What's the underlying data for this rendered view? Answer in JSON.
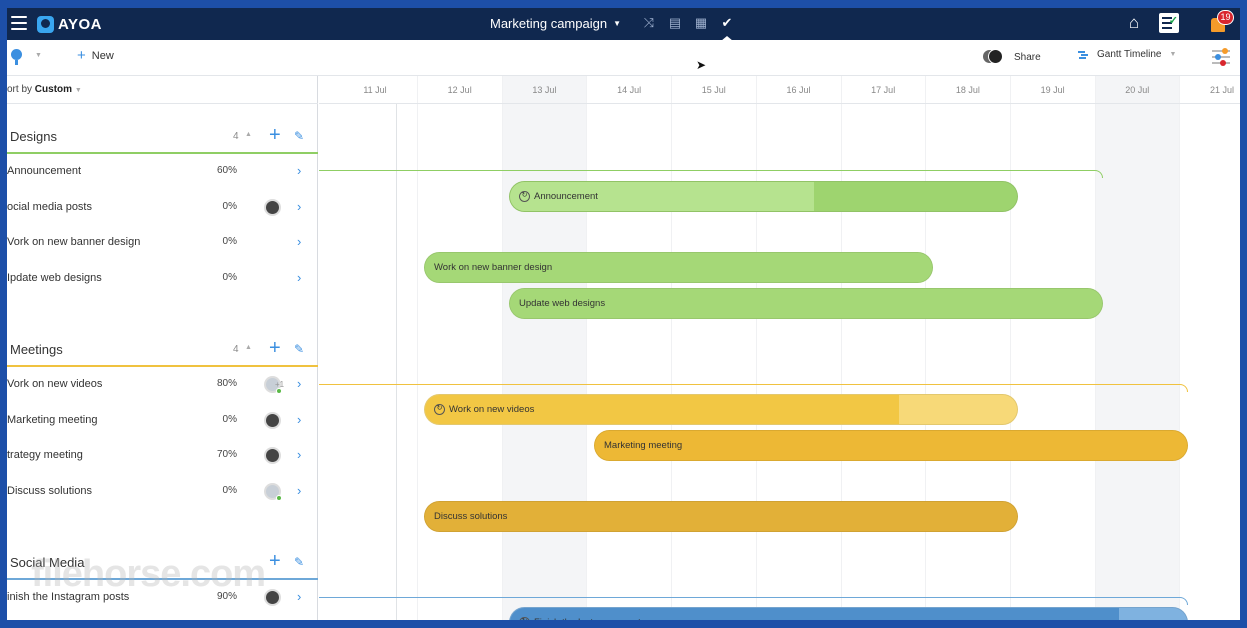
{
  "app": {
    "brand": "AYOA",
    "title": "Marketing campaign"
  },
  "topbar": {
    "notification_count": "19",
    "view_icons": [
      "mindmap-icon",
      "list-icon",
      "board-icon",
      "check-icon"
    ]
  },
  "toolbar": {
    "new_label": "New",
    "share_label": "Share",
    "view_label": "Gantt Timeline"
  },
  "sort": {
    "prefix": "ort by",
    "value": "Custom"
  },
  "dates": [
    "11 Jul",
    "12 Jul",
    "13 Jul",
    "14 Jul",
    "15 Jul",
    "16 Jul",
    "17 Jul",
    "18 Jul",
    "19 Jul",
    "20 Jul",
    "21 Jul"
  ],
  "groups": [
    {
      "name": "Designs",
      "count": "4",
      "color": "#8fce64",
      "tasks": [
        {
          "name": "Announcement",
          "pct": "60%",
          "avatar": false
        },
        {
          "name": "ocial media posts",
          "pct": "0%",
          "avatar": true
        },
        {
          "name": "Vork on new banner design",
          "pct": "0%",
          "avatar": false
        },
        {
          "name": "Ipdate web designs",
          "pct": "0%",
          "avatar": false
        }
      ]
    },
    {
      "name": "Meetings",
      "count": "4",
      "color": "#f0c23f",
      "tasks": [
        {
          "name": "Vork on new videos",
          "pct": "80%",
          "avatar": true,
          "extra": "+1"
        },
        {
          "name": "Marketing meeting",
          "pct": "0%",
          "avatar": true
        },
        {
          "name": "trategy meeting",
          "pct": "70%",
          "avatar": true
        },
        {
          "name": "Discuss solutions",
          "pct": "0%",
          "avatar": true
        }
      ]
    },
    {
      "name": "Social Media",
      "count": "",
      "color": "#6ea8d8",
      "tasks": [
        {
          "name": "inish the Instagram posts",
          "pct": "90%",
          "avatar": true
        }
      ]
    }
  ],
  "bars": [
    {
      "label": "Announcement",
      "progress": 0.6,
      "color": "#b6e38f",
      "fill": "#9ed46f",
      "icon": true
    },
    {
      "label": "Work on new banner design",
      "progress": 1.0,
      "color": "#a5d877",
      "fill": "#a5d877",
      "icon": false
    },
    {
      "label": "Update web designs",
      "progress": 1.0,
      "color": "#a5d877",
      "fill": "#a5d877",
      "icon": false
    },
    {
      "label": "Work on new videos",
      "progress": 0.8,
      "color": "#f2c744",
      "fill": "#f7d978",
      "icon": true
    },
    {
      "label": "Marketing meeting",
      "progress": 1.0,
      "color": "#edb835",
      "fill": "#edb835",
      "icon": false
    },
    {
      "label": "Discuss solutions",
      "progress": 1.0,
      "color": "#e2b038",
      "fill": "#e2b038",
      "icon": false
    },
    {
      "label": "Finish the Instagram posts",
      "progress": 0.9,
      "color": "#4f8fcb",
      "fill": "#7fb2e0",
      "icon": true
    }
  ],
  "watermark": "filehorse.com"
}
